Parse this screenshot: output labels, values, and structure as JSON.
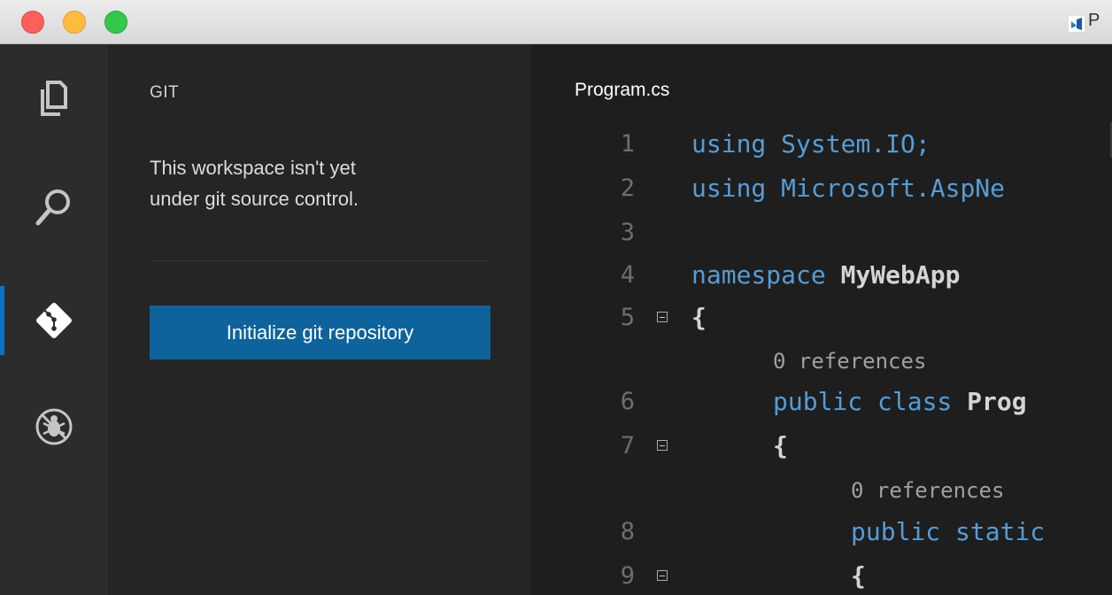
{
  "window": {
    "title_partial": "P",
    "traffic_colors": {
      "close": "#fc605c",
      "minimize": "#fdbc40",
      "zoom": "#34c84a"
    }
  },
  "activity_bar": {
    "items": [
      {
        "name": "explorer",
        "icon": "files-icon"
      },
      {
        "name": "search",
        "icon": "search-icon"
      },
      {
        "name": "git",
        "icon": "git-icon",
        "active": true
      },
      {
        "name": "debug",
        "icon": "debug-icon"
      }
    ],
    "active_color": "#0e70c0"
  },
  "sidebar": {
    "title": "GIT",
    "message_line1": "This workspace isn't yet",
    "message_line2": "under git source control.",
    "init_button_label": "Initialize git repository",
    "button_color": "#0e639c"
  },
  "editor": {
    "tab_title": "Program.cs",
    "lines": [
      {
        "num": "1",
        "kw": "using ",
        "rest": "System.IO;",
        "rest_is_kw": true
      },
      {
        "num": "2",
        "kw": "using ",
        "rest": "Microsoft.AspNe",
        "rest_is_kw": true
      },
      {
        "num": "3"
      },
      {
        "num": "4",
        "kw": "namespace ",
        "rest": "MyWebApp"
      },
      {
        "num": "5",
        "rest": "{",
        "fold": true
      },
      {
        "refs": "0 references"
      },
      {
        "num": "6",
        "kw": "public class ",
        "rest": "Prog"
      },
      {
        "num": "7",
        "rest": "{",
        "fold": true
      },
      {
        "refs": "0 references"
      },
      {
        "num": "8",
        "kw": "public static",
        "rest": ""
      },
      {
        "num": "9",
        "rest": "{",
        "fold": true
      }
    ],
    "keyword_color": "#569cd6"
  }
}
